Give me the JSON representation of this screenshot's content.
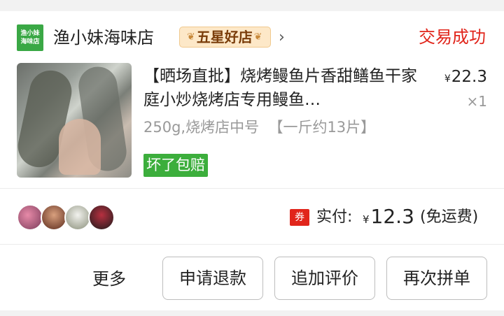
{
  "shop": {
    "logo_line1": "渔小妹",
    "logo_line2": "海味店",
    "name": "渔小妹海味店",
    "badge": "五星好店",
    "chevron": "›"
  },
  "order": {
    "status": "交易成功",
    "status_color": "#e1251b"
  },
  "product": {
    "title": "【晒场直批】烧烤鳗鱼片香甜鳝鱼干家庭小炒烧烤店专用鳗鱼…",
    "price_symbol": "¥",
    "price": "22.3",
    "quantity": "×1",
    "spec": "250g,烧烤店中号  【一斤约13片】",
    "guarantee": "坏了包赔",
    "guarantee_color": "#3cae3c"
  },
  "payment": {
    "coupon_icon": "券",
    "label": "实付:",
    "symbol": "¥",
    "amount": "12.3",
    "shipping": "(免运费)"
  },
  "actions": {
    "more": "更多",
    "refund": "申请退款",
    "review": "追加评价",
    "regroup": "再次拼单"
  }
}
